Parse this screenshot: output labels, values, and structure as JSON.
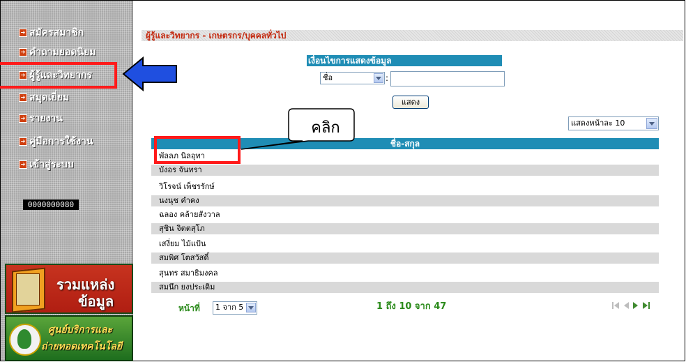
{
  "sidebar": {
    "items": [
      {
        "label": "สมัครสมาชิก"
      },
      {
        "label": "คำถามยอดนิยม"
      },
      {
        "label": "ผู้รู้และวิทยากร"
      },
      {
        "label": "สมุดเยี่ยม"
      },
      {
        "label": "รายงาน"
      },
      {
        "label": "คู่มือการใช้งาน"
      },
      {
        "label": "เข้าสู่ระบบ"
      }
    ],
    "counter": "0000000080",
    "banner1": {
      "line1": "รวมแหล่ง",
      "line2": "ข้อมูล"
    },
    "banner2": {
      "line1": "ศูนย์บริการและ",
      "line2": "ถ่ายทอดเทคโนโลยี"
    }
  },
  "main": {
    "page_title": "ผู้รู้และวิทยากร - เกษตรกร/บุคคลทั่วไป",
    "filter": {
      "title": "เงื่อนไขการแสดงข้อมูล",
      "field_value": "ชื่อ",
      "colon": ":",
      "input_value": "",
      "show_button": "แสดง"
    },
    "page_size": "แสดงหน้าละ 10",
    "table": {
      "header": "ชื่อ-สกุล",
      "rows": [
        "พัลลภ นิลอุทา",
        "บังอร จันทรา",
        "วิโรจน์ เพ็ชรรักษ์",
        "นงนุช คำคง",
        "ฉลอง คล้ายสังวาล",
        "สุชิน จิตตสุโภ",
        "เสงี่ยม ไม้แป้น",
        "สมพิศ โตสวัสดิ์",
        "สุนทร สมาธิมงคล",
        "สมนึก ยงประเดิม"
      ]
    },
    "pager": {
      "label": "หน้าที่",
      "page_select": "1 จาก 5",
      "range": "1 ถึง 10 จาก 47"
    }
  },
  "annotation": {
    "callout": "คลิก",
    "colors": {
      "highlight": "#ff1a1a",
      "arrow": "#1f4fe0"
    }
  },
  "icons": [
    "bullet-icon",
    "dropdown-arrow-icon",
    "first-page-icon",
    "prev-page-icon",
    "next-page-icon",
    "last-page-icon",
    "pointer-arrow-icon"
  ]
}
